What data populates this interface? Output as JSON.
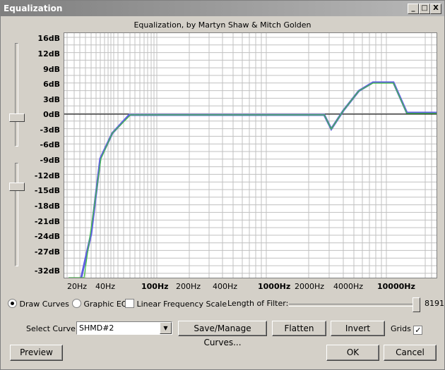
{
  "window": {
    "title": "Equalization",
    "buttons": [
      "_",
      "□",
      "X"
    ]
  },
  "subtitle": "Equalization, by Martyn Shaw & Mitch Golden",
  "plot": {
    "y_labels": [
      "16dB",
      "12dB",
      "9dB",
      "6dB",
      "3dB",
      "0dB",
      "-3dB",
      "-6dB",
      "-9dB",
      "-12dB",
      "-15dB",
      "-18dB",
      "-21dB",
      "-24dB",
      "-27dB",
      "-32dB"
    ],
    "x_labels": [
      {
        "text": "20Hz",
        "bold": false
      },
      {
        "text": "40Hz",
        "bold": false
      },
      {
        "text": "100Hz",
        "bold": true
      },
      {
        "text": "200Hz",
        "bold": false
      },
      {
        "text": "400Hz",
        "bold": false
      },
      {
        "text": "1000Hz",
        "bold": true
      },
      {
        "text": "2000Hz",
        "bold": false
      },
      {
        "text": "4000Hz",
        "bold": false
      },
      {
        "text": "10000Hz",
        "bold": true
      }
    ],
    "colors": {
      "curve_blue": "#6060e0",
      "curve_green": "#40c040",
      "grid": "#c0c0c0",
      "zero_line": "#000000"
    }
  },
  "controls": {
    "draw_curves": "Draw Curves",
    "graphic_eq": "Graphic EQ",
    "linear_freq": "Linear Frequency Scale",
    "length_label": "Length of Filter:",
    "length_value": "8191",
    "select_curve_label": "Select Curve:",
    "select_curve_value": "SHMD#2",
    "save_manage": "Save/Manage Curves...",
    "flatten": "Flatten",
    "invert": "Invert",
    "grids": "Grids",
    "grids_checked": "✓",
    "preview": "Preview",
    "ok": "OK",
    "cancel": "Cancel"
  }
}
